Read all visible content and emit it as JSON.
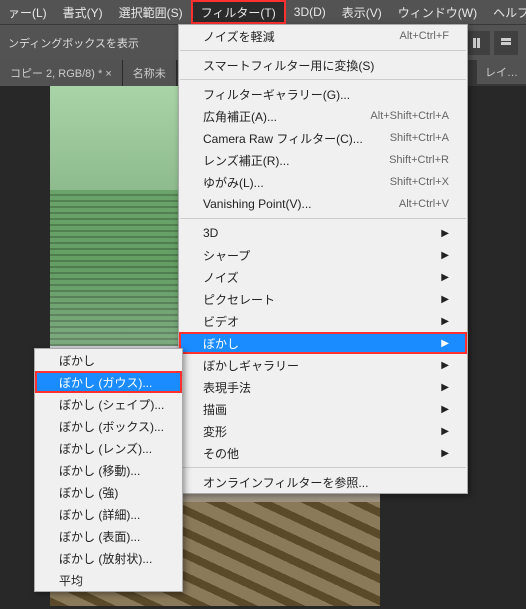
{
  "menubar": {
    "items": [
      {
        "label": "ァー(L)"
      },
      {
        "label": "書式(Y)"
      },
      {
        "label": "選択範囲(S)"
      },
      {
        "label": "フィルター(T)"
      },
      {
        "label": "3D(D)"
      },
      {
        "label": "表示(V)"
      },
      {
        "label": "ウィンドウ(W)"
      },
      {
        "label": "ヘルプ(H)"
      }
    ]
  },
  "toolbar": {
    "text": "ンディングボックスを表示"
  },
  "tabs": {
    "items": [
      {
        "label": "コピー 2, RGB/8) * ×"
      },
      {
        "label": "名称未"
      },
      {
        "label": "レイ…"
      }
    ]
  },
  "filter_menu": {
    "items": [
      {
        "label": "ノイズを軽減",
        "shortcut": "Alt+Ctrl+F"
      },
      {
        "sep": true
      },
      {
        "label": "スマートフィルター用に変換(S)"
      },
      {
        "sep": true
      },
      {
        "label": "フィルターギャラリー(G)..."
      },
      {
        "label": "広角補正(A)...",
        "shortcut": "Alt+Shift+Ctrl+A"
      },
      {
        "label": "Camera Raw フィルター(C)...",
        "shortcut": "Shift+Ctrl+A"
      },
      {
        "label": "レンズ補正(R)...",
        "shortcut": "Shift+Ctrl+R"
      },
      {
        "label": "ゆがみ(L)...",
        "shortcut": "Shift+Ctrl+X"
      },
      {
        "label": "Vanishing Point(V)...",
        "shortcut": "Alt+Ctrl+V"
      },
      {
        "sep": true
      },
      {
        "label": "3D",
        "sub": true
      },
      {
        "label": "シャープ",
        "sub": true
      },
      {
        "label": "ノイズ",
        "sub": true
      },
      {
        "label": "ピクセレート",
        "sub": true
      },
      {
        "label": "ビデオ",
        "sub": true
      },
      {
        "label": "ぼかし",
        "sub": true,
        "hover": true,
        "highlight": true
      },
      {
        "label": "ぼかしギャラリー",
        "sub": true
      },
      {
        "label": "表現手法",
        "sub": true
      },
      {
        "label": "描画",
        "sub": true
      },
      {
        "label": "変形",
        "sub": true
      },
      {
        "label": "その他",
        "sub": true
      },
      {
        "sep": true
      },
      {
        "label": "オンラインフィルターを参照..."
      }
    ]
  },
  "blur_submenu": {
    "items": [
      {
        "label": "ぼかし"
      },
      {
        "label": "ぼかし (ガウス)...",
        "hover": true,
        "highlight": true
      },
      {
        "label": "ぼかし (シェイプ)..."
      },
      {
        "label": "ぼかし (ボックス)..."
      },
      {
        "label": "ぼかし (レンズ)..."
      },
      {
        "label": "ぼかし (移動)..."
      },
      {
        "label": "ぼかし (強)"
      },
      {
        "label": "ぼかし (詳細)..."
      },
      {
        "label": "ぼかし (表面)..."
      },
      {
        "label": "ぼかし (放射状)..."
      },
      {
        "label": "平均"
      }
    ]
  }
}
